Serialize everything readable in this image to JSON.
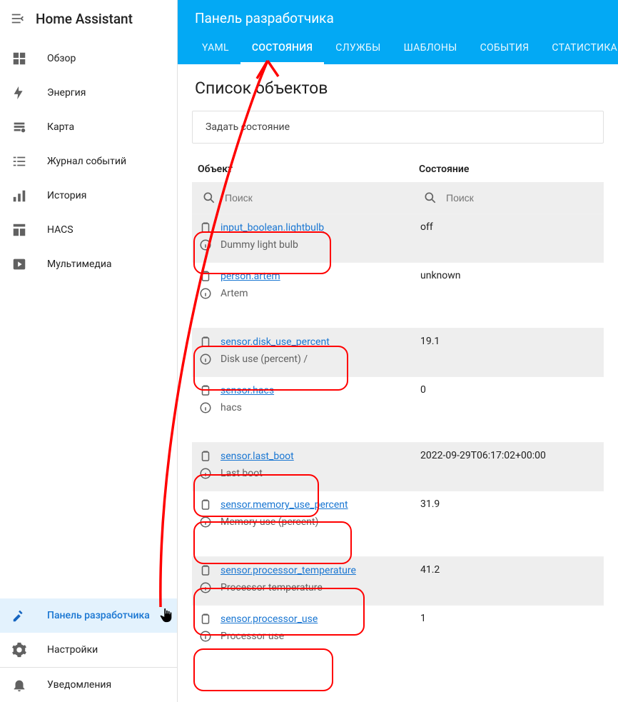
{
  "app_title": "Home Assistant",
  "sidebar": {
    "items": [
      {
        "label": "Обзор",
        "icon": "dashboard"
      },
      {
        "label": "Энергия",
        "icon": "bolt"
      },
      {
        "label": "Карта",
        "icon": "map"
      },
      {
        "label": "Журнал событий",
        "icon": "logbook"
      },
      {
        "label": "История",
        "icon": "history"
      },
      {
        "label": "HACS",
        "icon": "hacs"
      },
      {
        "label": "Мультимедиа",
        "icon": "media"
      }
    ],
    "dev_panel": "Панель разработчика",
    "settings": "Настройки",
    "notifications": "Уведомления"
  },
  "header": {
    "title": "Панель разработчика",
    "tabs": [
      "YAML",
      "СОСТОЯНИЯ",
      "СЛУЖБЫ",
      "ШАБЛОНЫ",
      "СОБЫТИЯ",
      "СТАТИСТИКА"
    ],
    "active_tab": 1
  },
  "list_title": "Список объектов",
  "set_state_label": "Задать состояние",
  "columns": {
    "object": "Объект",
    "state": "Состояние"
  },
  "search_placeholder": "Поиск",
  "entities": [
    {
      "id": "input_boolean.lightbulb",
      "friendly": "Dummy light bulb",
      "state": "off",
      "hl": true
    },
    {
      "id": "person.artem",
      "friendly": "Artem",
      "state": "unknown",
      "hl": false
    },
    {
      "id": "sensor.disk_use_percent",
      "friendly": "Disk use (percent) /",
      "state": "19.1",
      "hl": true
    },
    {
      "id": "sensor.hacs",
      "friendly": "hacs",
      "state": "0",
      "hl": false
    },
    {
      "id": "sensor.last_boot",
      "friendly": "Last boot",
      "state": "2022-09-29T06:17:02+00:00",
      "hl": true
    },
    {
      "id": "sensor.memory_use_percent",
      "friendly": "Memory use (percent)",
      "state": "31.9",
      "hl": true
    },
    {
      "id": "sensor.processor_temperature",
      "friendly": "Processor temperature",
      "state": "41.2",
      "hl": true
    },
    {
      "id": "sensor.processor_use",
      "friendly": "Processor use",
      "state": "1",
      "hl": true
    }
  ]
}
